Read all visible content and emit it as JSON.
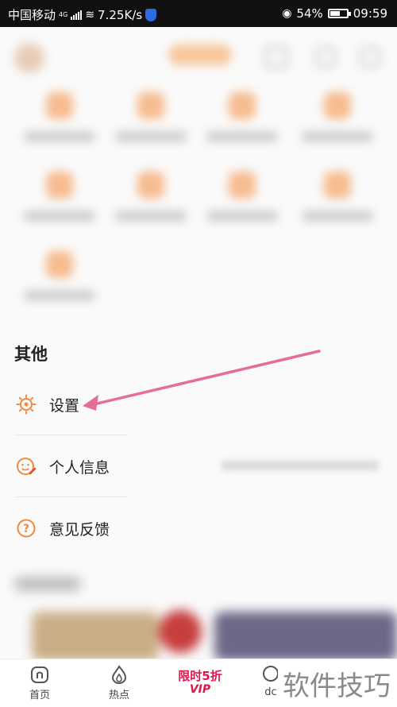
{
  "status_bar": {
    "carrier": "中国移动",
    "network": "4G",
    "speed": "7.25K/s",
    "battery_percent": "54%",
    "battery_level": 0.54,
    "time": "09:59"
  },
  "others_section": {
    "title": "其他",
    "items": [
      {
        "label": "设置",
        "icon": "gear-icon"
      },
      {
        "label": "个人信息",
        "icon": "face-edit-icon"
      },
      {
        "label": "意见反馈",
        "icon": "question-icon"
      }
    ]
  },
  "tab_bar": {
    "tabs": [
      {
        "label": "首页",
        "icon": "home-icon"
      },
      {
        "label": "热点",
        "icon": "flame-icon"
      },
      {
        "label": "dc",
        "icon": "chat-icon"
      }
    ],
    "vip_line1": "限时5折",
    "vip_line2": "VIP"
  },
  "watermark": "软件技巧",
  "colors": {
    "accent": "#f08a3c",
    "arrow": "#e56e94",
    "vip": "#e0174c"
  }
}
